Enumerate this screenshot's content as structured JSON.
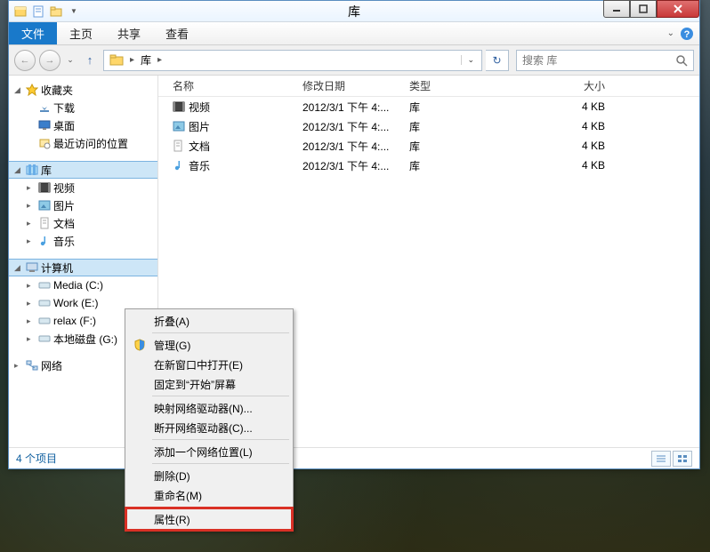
{
  "window": {
    "title": "库"
  },
  "menu": {
    "file": "文件",
    "home": "主页",
    "share": "共享",
    "view": "查看"
  },
  "breadcrumb": {
    "root": "库",
    "search_placeholder": "搜索 库"
  },
  "sidebar": {
    "favorites": {
      "label": "收藏夹",
      "items": [
        {
          "label": "下载"
        },
        {
          "label": "桌面"
        },
        {
          "label": "最近访问的位置"
        }
      ]
    },
    "libraries": {
      "label": "库",
      "items": [
        {
          "label": "视频"
        },
        {
          "label": "图片"
        },
        {
          "label": "文档"
        },
        {
          "label": "音乐"
        }
      ]
    },
    "computer": {
      "label": "计算机",
      "items": [
        {
          "label": "Media (C:)"
        },
        {
          "label": "Work (E:)"
        },
        {
          "label": "relax (F:)"
        },
        {
          "label": "本地磁盘 (G:)"
        }
      ]
    },
    "network": {
      "label": "网络"
    }
  },
  "columns": {
    "name": "名称",
    "date": "修改日期",
    "type": "类型",
    "size": "大小"
  },
  "files": [
    {
      "name": "视频",
      "date": "2012/3/1 下午 4:...",
      "type": "库",
      "size": "4 KB"
    },
    {
      "name": "图片",
      "date": "2012/3/1 下午 4:...",
      "type": "库",
      "size": "4 KB"
    },
    {
      "name": "文档",
      "date": "2012/3/1 下午 4:...",
      "type": "库",
      "size": "4 KB"
    },
    {
      "name": "音乐",
      "date": "2012/3/1 下午 4:...",
      "type": "库",
      "size": "4 KB"
    }
  ],
  "status": {
    "count": "4 个项目"
  },
  "contextmenu": {
    "collapse": "折叠(A)",
    "manage": "管理(G)",
    "new_window": "在新窗口中打开(E)",
    "pin_start": "固定到“开始”屏幕",
    "map_drive": "映射网络驱动器(N)...",
    "disconnect_drive": "断开网络驱动器(C)...",
    "add_location": "添加一个网络位置(L)",
    "delete": "删除(D)",
    "rename": "重命名(M)",
    "properties": "属性(R)"
  }
}
